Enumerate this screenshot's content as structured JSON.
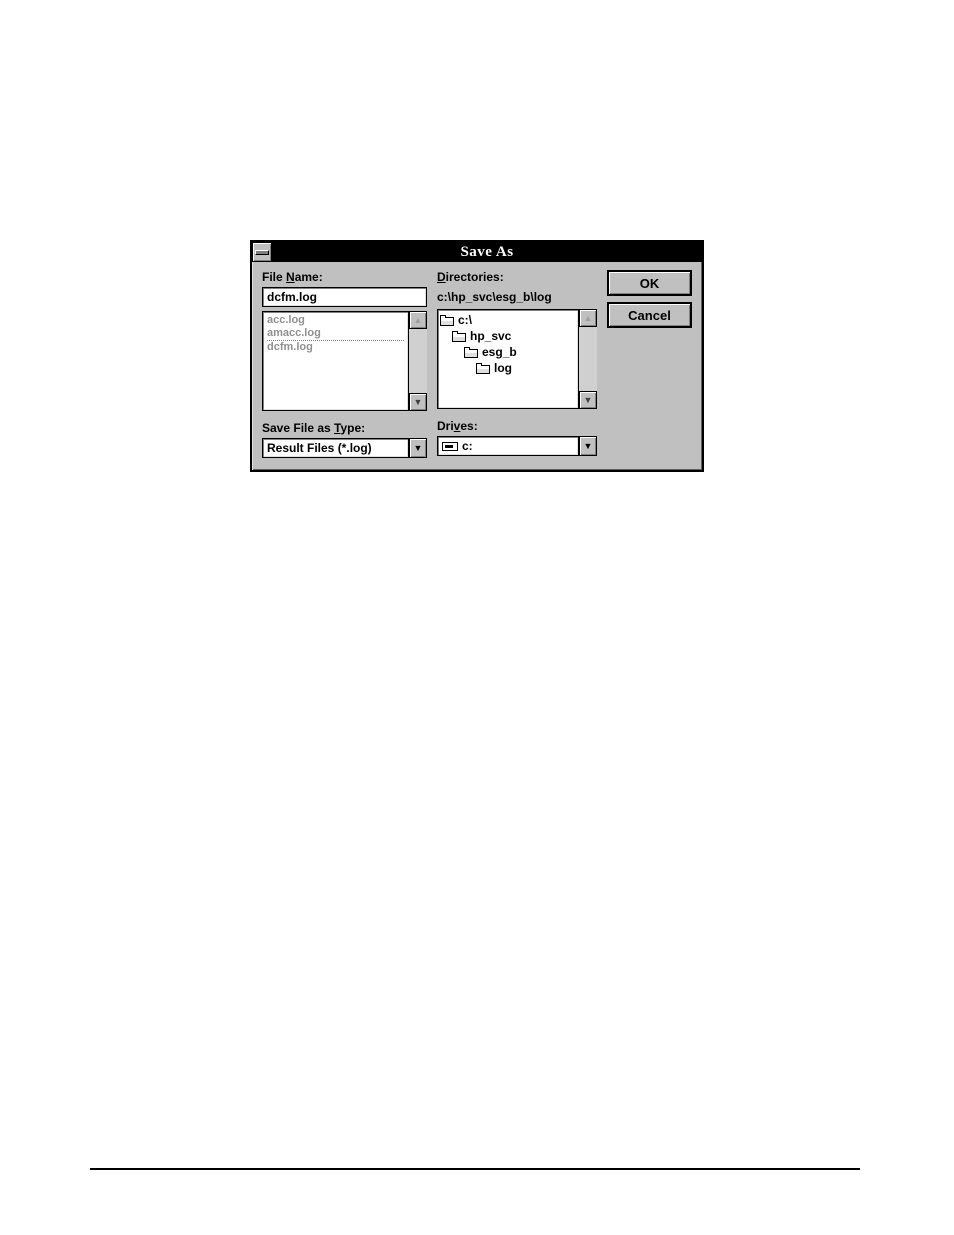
{
  "dialog": {
    "title": "Save As",
    "file_name_label_pre": "File ",
    "file_name_label_u": "N",
    "file_name_label_post": "ame:",
    "file_name_value": "dcfm.log",
    "file_list": [
      "acc.log",
      "amacc.log",
      "dcfm.log"
    ],
    "directories_label_u": "D",
    "directories_label_post": "irectories:",
    "directories_path": "c:\\hp_svc\\esg_b\\log",
    "tree": [
      {
        "label": "c:\\",
        "indent": 0
      },
      {
        "label": "hp_svc",
        "indent": 1
      },
      {
        "label": "esg_b",
        "indent": 2
      },
      {
        "label": "log",
        "indent": 3
      }
    ],
    "save_type_label_pre": "Save File as ",
    "save_type_label_u": "T",
    "save_type_label_post": "ype:",
    "save_type_value": "Result Files (*.log)",
    "drives_label_pre": "Dri",
    "drives_label_u": "v",
    "drives_label_post": "es:",
    "drives_value": "c:",
    "ok_label": "OK",
    "cancel_label": "Cancel"
  }
}
